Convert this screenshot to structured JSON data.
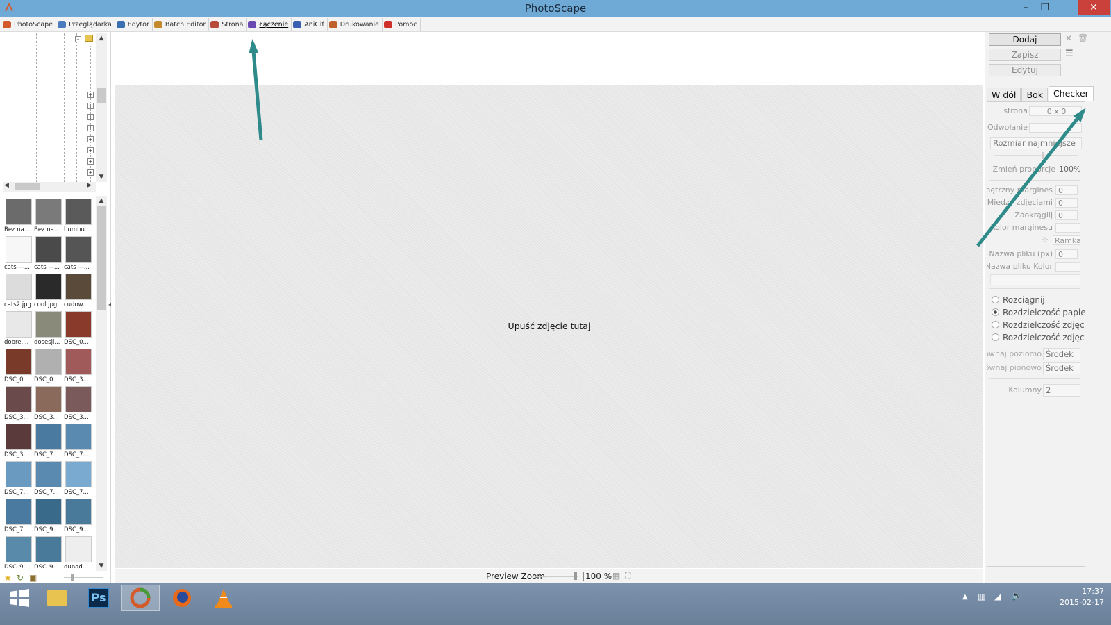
{
  "window": {
    "title": "PhotoScape"
  },
  "menu": [
    {
      "label": "PhotoScape",
      "color": "#d35a2a",
      "active": false
    },
    {
      "label": "Przeglądarka",
      "color": "#4a7bbf",
      "active": false
    },
    {
      "label": "Edytor",
      "color": "#3a6fb0",
      "active": false
    },
    {
      "label": "Batch Editor",
      "color": "#c28a2a",
      "active": false
    },
    {
      "label": "Strona",
      "color": "#b84a3a",
      "active": false
    },
    {
      "label": "Łączenie",
      "color": "#6a4ab0",
      "active": true
    },
    {
      "label": "AniGif",
      "color": "#3a5fb0",
      "active": false
    },
    {
      "label": "Drukowanie",
      "color": "#c0602a",
      "active": false
    },
    {
      "label": "Pomoc",
      "color": "#d0302a",
      "active": false
    }
  ],
  "thumbnails": [
    {
      "label": "Bez na...",
      "tone": "#6b6b6b"
    },
    {
      "label": "Bez na...",
      "tone": "#7a7a7a"
    },
    {
      "label": "bumbu...",
      "tone": "#5a5a5a"
    },
    {
      "label": "cats —...",
      "tone": "#f7f7f7"
    },
    {
      "label": "cats —...",
      "tone": "#4a4a4a"
    },
    {
      "label": "cats —...",
      "tone": "#555555"
    },
    {
      "label": "cats2.jpg",
      "tone": "#dcdcdc"
    },
    {
      "label": "cool.jpg",
      "tone": "#2a2a2a"
    },
    {
      "label": "cudow...",
      "tone": "#5a4a3a"
    },
    {
      "label": "dobre....",
      "tone": "#e8e8e8"
    },
    {
      "label": "dosesji...",
      "tone": "#8a8a7a"
    },
    {
      "label": "DSC_0...",
      "tone": "#8a3a2a"
    },
    {
      "label": "DSC_0...",
      "tone": "#7a3a2a"
    },
    {
      "label": "DSC_0...",
      "tone": "#b0b0b0"
    },
    {
      "label": "DSC_3...",
      "tone": "#a05a5a"
    },
    {
      "label": "DSC_3...",
      "tone": "#6a4a4a"
    },
    {
      "label": "DSC_3...",
      "tone": "#8a6a5a"
    },
    {
      "label": "DSC_3...",
      "tone": "#7a5a5a"
    },
    {
      "label": "DSC_3...",
      "tone": "#5a3a3a"
    },
    {
      "label": "DSC_7...",
      "tone": "#4a7aa0"
    },
    {
      "label": "DSC_7...",
      "tone": "#5a8ab0"
    },
    {
      "label": "DSC_7...",
      "tone": "#6a9ac0"
    },
    {
      "label": "DSC_7...",
      "tone": "#5a8ab0"
    },
    {
      "label": "DSC_7...",
      "tone": "#7aaad0"
    },
    {
      "label": "DSC_7...",
      "tone": "#4a7aa0"
    },
    {
      "label": "DSC_9...",
      "tone": "#3a6a8a"
    },
    {
      "label": "DSC_9...",
      "tone": "#4a7a9a"
    },
    {
      "label": "DSC_9...",
      "tone": "#5a8aaa"
    },
    {
      "label": "DSC_9...",
      "tone": "#4a7a9a"
    },
    {
      "label": "dupad...",
      "tone": "#eeeeee"
    }
  ],
  "canvas": {
    "drop_text": "Upuść zdjęcie tutaj"
  },
  "status": {
    "preview_zoom_label": "Preview Zoom",
    "zoom_value": "100 %"
  },
  "right": {
    "add": "Dodaj",
    "save": "Zapisz",
    "edit": "Edytuj",
    "tabs": [
      "W dół",
      "Bok",
      "Checker"
    ],
    "strona_label": "strona",
    "strona_value": "0 x 0",
    "odwolanie_label": "Odwołanie",
    "size_select": "Rozmiar najmniejsze",
    "proportion_label": "Zmień proporcje",
    "proportion_value": "100%",
    "margin_outer_label": "Zewnętrzny margines",
    "margin_outer_value": "0",
    "margin_between_label": "Między zdjęciami",
    "margin_between_value": "0",
    "round_label": "Zaokrąglij",
    "round_value": "0",
    "margin_color_label": "Kolor marginesu",
    "frame_label": "Ramka",
    "filename_px_label": "Nazwa pliku (px)",
    "filename_px_value": "0",
    "filename_color_label": "Nazwa pliku Kolor",
    "radio": [
      {
        "label": "Rozciągnij",
        "checked": false
      },
      {
        "label": "Rozdzielczość papieru",
        "checked": true
      },
      {
        "label": "Rozdzielczość zdjęcia",
        "checked": false
      },
      {
        "label": "Rozdzielczość zdjęcia (",
        "checked": false
      }
    ],
    "align_h_label": "Wyrównaj poziomo",
    "align_h_value": "Środek",
    "align_v_label": "Wyrównaj pionowo",
    "align_v_value": "Środek",
    "columns_label": "Kolumny",
    "columns_value": "2"
  },
  "taskbar": {
    "time": "17:37",
    "date": "2015-02-17",
    "ps_label": "Ps"
  },
  "annotation_color": "#2f8a8a"
}
